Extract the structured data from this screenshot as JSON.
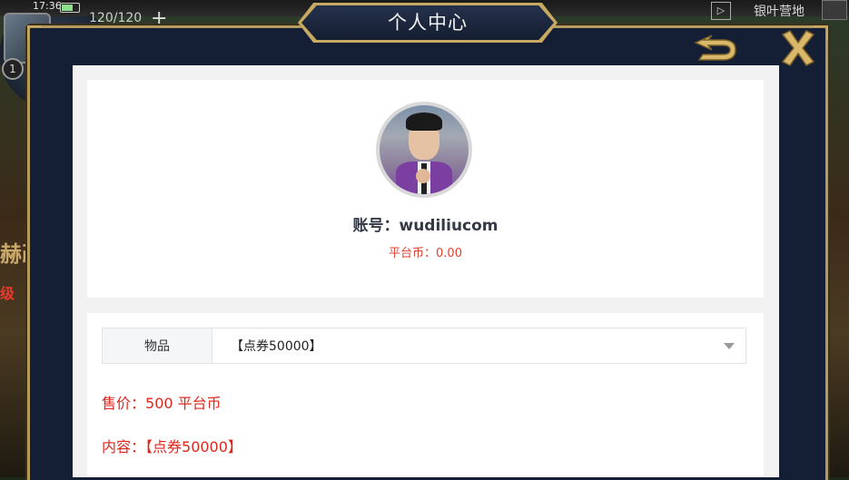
{
  "status_bar": {
    "time": "17:36",
    "energy": "120/120",
    "plus": "+"
  },
  "hud": {
    "level": "1",
    "zone_label": "银叶营地",
    "zone_icon": "▷",
    "side_text_top": "赫改",
    "side_text_bottom": "级"
  },
  "modal": {
    "title": "个人中心",
    "back_icon": "back-arrow-icon",
    "close_icon": "close-x-icon",
    "frame_color": "#c8a962",
    "panel_color": "#141e34"
  },
  "profile": {
    "account_prefix": "账号：",
    "account": "wudiliucom",
    "coins_prefix": "平台币：",
    "coins": "0.00",
    "coins_color": "#e0422f"
  },
  "order": {
    "item_label": "物品",
    "item_selected": "【点券50000】",
    "price_label": "售价：",
    "price_value": "500 平台币",
    "content_label": "内容：",
    "content_value": "【点券50000】",
    "accent": "#e0261b"
  }
}
